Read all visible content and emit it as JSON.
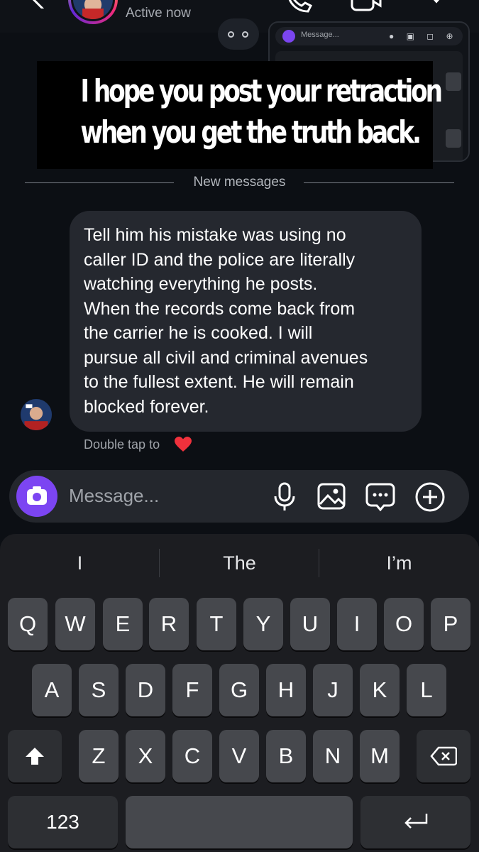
{
  "header": {
    "status": "Active now",
    "icons": [
      "back-arrow-icon",
      "phone-icon",
      "video-camera-icon",
      "info-icon"
    ]
  },
  "background_preview": {
    "message_placeholder": "Message..."
  },
  "overlay_caption": {
    "line1": "I hope you post your retraction",
    "line2": "when you get the truth back."
  },
  "divider": {
    "label": "New messages"
  },
  "message": {
    "text": "Tell him his mistake was using no\ncaller ID and the police are literally\nwatching everything he posts.\nWhen the records come back from\nthe carrier he is cooked.  I will\npursue all civil and criminal avenues\nto the fullest extent.  He will remain\nblocked forever.",
    "reaction_hint": "Double tap to"
  },
  "composer": {
    "placeholder": "Message...",
    "accent_color": "#7c45f2",
    "icons": [
      "camera-icon",
      "mic-icon",
      "gallery-icon",
      "sticker-icon",
      "plus-icon"
    ]
  },
  "keyboard": {
    "suggestions": [
      "I",
      "The",
      "I’m"
    ],
    "row1": [
      "Q",
      "W",
      "E",
      "R",
      "T",
      "Y",
      "U",
      "I",
      "O",
      "P"
    ],
    "row2": [
      "A",
      "S",
      "D",
      "F",
      "G",
      "H",
      "J",
      "K",
      "L"
    ],
    "row3": [
      "Z",
      "X",
      "C",
      "V",
      "B",
      "N",
      "M"
    ],
    "numbers_key": "123"
  }
}
